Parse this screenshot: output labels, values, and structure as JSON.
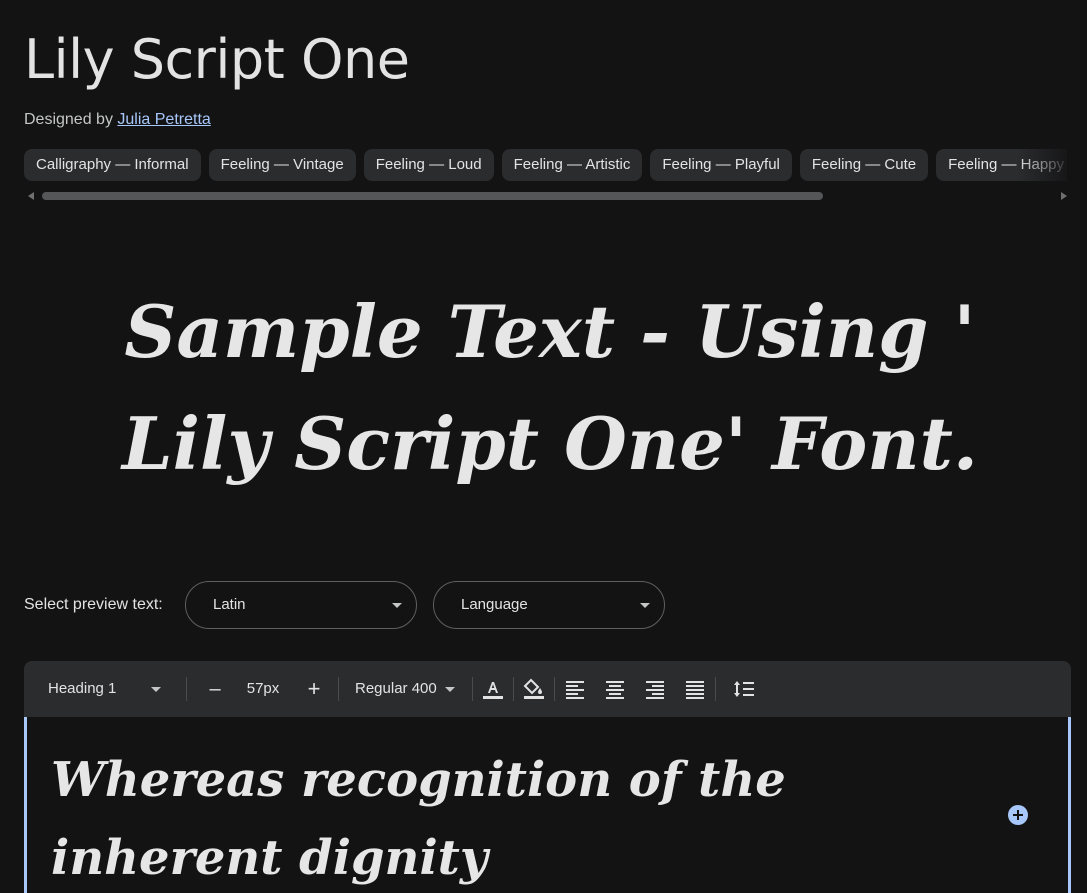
{
  "header": {
    "title": "Lily Script One",
    "designed_by_prefix": "Designed by",
    "designer_name": "Julia Petretta"
  },
  "tags": [
    "Calligraphy — Informal",
    "Feeling — Vintage",
    "Feeling — Loud",
    "Feeling — Artistic",
    "Feeling — Playful",
    "Feeling — Cute",
    "Feeling — Happy"
  ],
  "sample_text": "Sample Text - Using ' Lily Script One' Font.",
  "preview": {
    "label": "Select preview text:",
    "script_value": "Latin",
    "language_value": "Language"
  },
  "toolbar": {
    "style_value": "Heading 1",
    "decrease_label": "–",
    "size_value": "57px",
    "increase_label": "+",
    "weight_value": "Regular 400"
  },
  "editor": {
    "text": "Whereas recognition of the inherent dignity"
  },
  "colors": {
    "background": "#131314",
    "accent": "#a8c7fa",
    "chip": "#2b2c2e"
  },
  "icons": {
    "text_color": "text-color-icon",
    "highlight": "fill-bucket-icon",
    "align_left": "align-left-icon",
    "align_center": "align-center-icon",
    "align_right": "align-right-icon",
    "align_justify": "align-justify-icon",
    "line_height": "line-height-icon",
    "add": "add-circle-icon"
  }
}
